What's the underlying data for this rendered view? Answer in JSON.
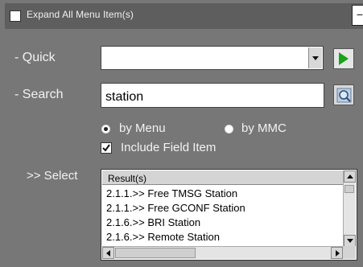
{
  "header": {
    "expand_label": "Expand All Menu Item(s)",
    "collapse_symbol": "−"
  },
  "quick": {
    "label": "- Quick",
    "value": ""
  },
  "search": {
    "label": "- Search",
    "value": "station"
  },
  "search_mode": {
    "options": [
      "by Menu",
      "by MMC"
    ],
    "selected": "by Menu",
    "include_field_label": "Include Field Item",
    "include_field_checked": true
  },
  "select": {
    "label": ">> Select",
    "results_header": "Result(s)",
    "rows": [
      "2.1.1.>> Free TMSG Station",
      "2.1.1.>> Free GCONF Station",
      "2.1.6.>> BRI Station",
      "2.1.6.>> Remote Station"
    ]
  },
  "colors": {
    "panel_bg": "#777777",
    "topbar_bg": "#5e5e5e",
    "go_arrow": "#17a317"
  }
}
